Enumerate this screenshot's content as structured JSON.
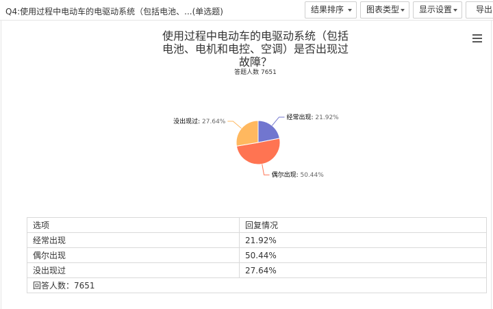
{
  "header": {
    "question_title": "Q4:使用过程中电动车的电驱动系统（包括电池、...(单选题)",
    "buttons": {
      "sort": "结果排序",
      "chart_type": "图表类型",
      "display_settings": "显示设置",
      "export": "导出"
    }
  },
  "chart": {
    "title_lines": [
      "使用过程中电动车的电驱动系统（包括",
      "电池、电机和电控、空调）是否出现过",
      "故障？"
    ],
    "subtitle": "答题人数 7651",
    "menu_icon": "hamburger-menu-icon"
  },
  "chart_data": {
    "type": "pie",
    "title": "使用过程中电动车的电驱动系统（包括电池、电机和电控、空调）是否出现过故障？",
    "subtitle": "答题人数 7651",
    "slices": [
      {
        "label": "经常出现",
        "value": 21.92,
        "display": "21.92%",
        "color": "#7176cf"
      },
      {
        "label": "偶尔出现",
        "value": 50.44,
        "display": "50.44%",
        "color": "#ff7452"
      },
      {
        "label": "没出现过",
        "value": 27.64,
        "display": "27.64%",
        "color": "#ffb85f"
      }
    ]
  },
  "table": {
    "headers": [
      "选项",
      "回复情况"
    ],
    "rows": [
      [
        "经常出现",
        "21.92%"
      ],
      [
        "偶尔出现",
        "50.44%"
      ],
      [
        "没出现过",
        "27.64%"
      ]
    ],
    "footer": "回答人数：7651"
  }
}
